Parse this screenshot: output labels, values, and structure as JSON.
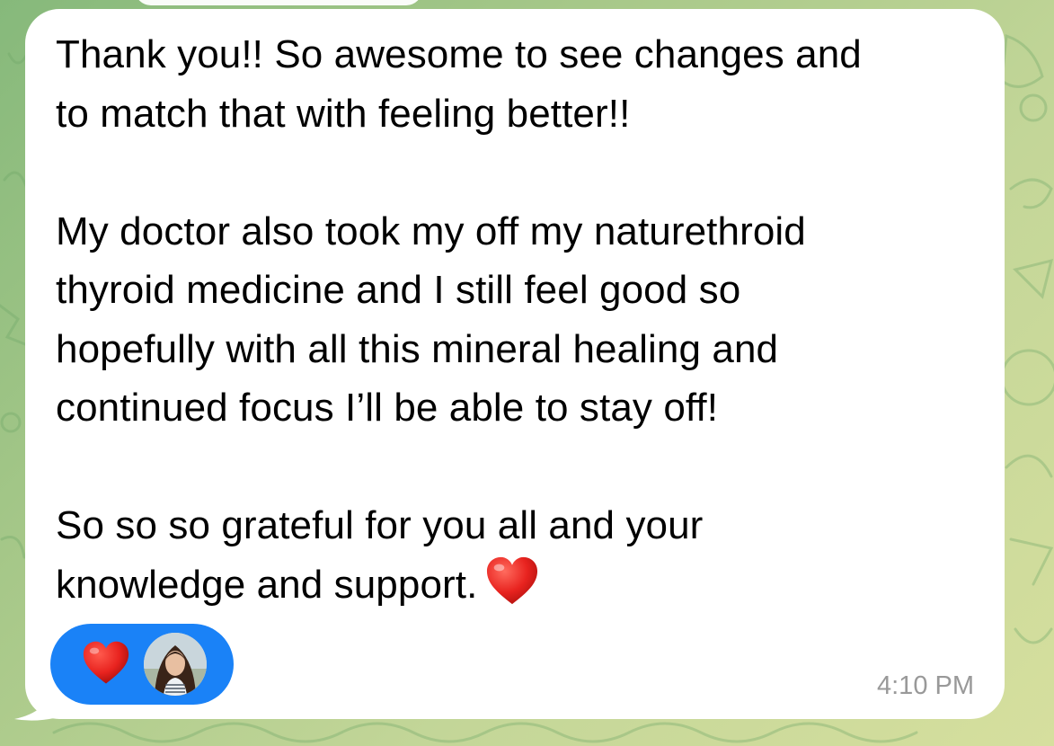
{
  "message": {
    "paragraphs": [
      "Thank you!! So awesome to see changes and\nto match that with feeling better!!",
      "My doctor also took my off my naturethroid\nthyroid medicine and I still feel good so\nhopefully with all this mineral healing and\ncontinued focus I’ll be able to stay off!",
      "So so so grateful for you all and your\nknowledge and support."
    ],
    "trailing_emoji": "heart-emoji",
    "timestamp": "4:10 PM"
  },
  "reaction": {
    "emoji": "heart-icon",
    "reactor_avatar": "avatar",
    "pill_color": "#1a82f7"
  },
  "colors": {
    "bubble": "#ffffff",
    "wallpaper_start": "#86b97b",
    "wallpaper_end": "#d6df9e",
    "heart": "#e8231f",
    "timestamp": "#999999"
  }
}
